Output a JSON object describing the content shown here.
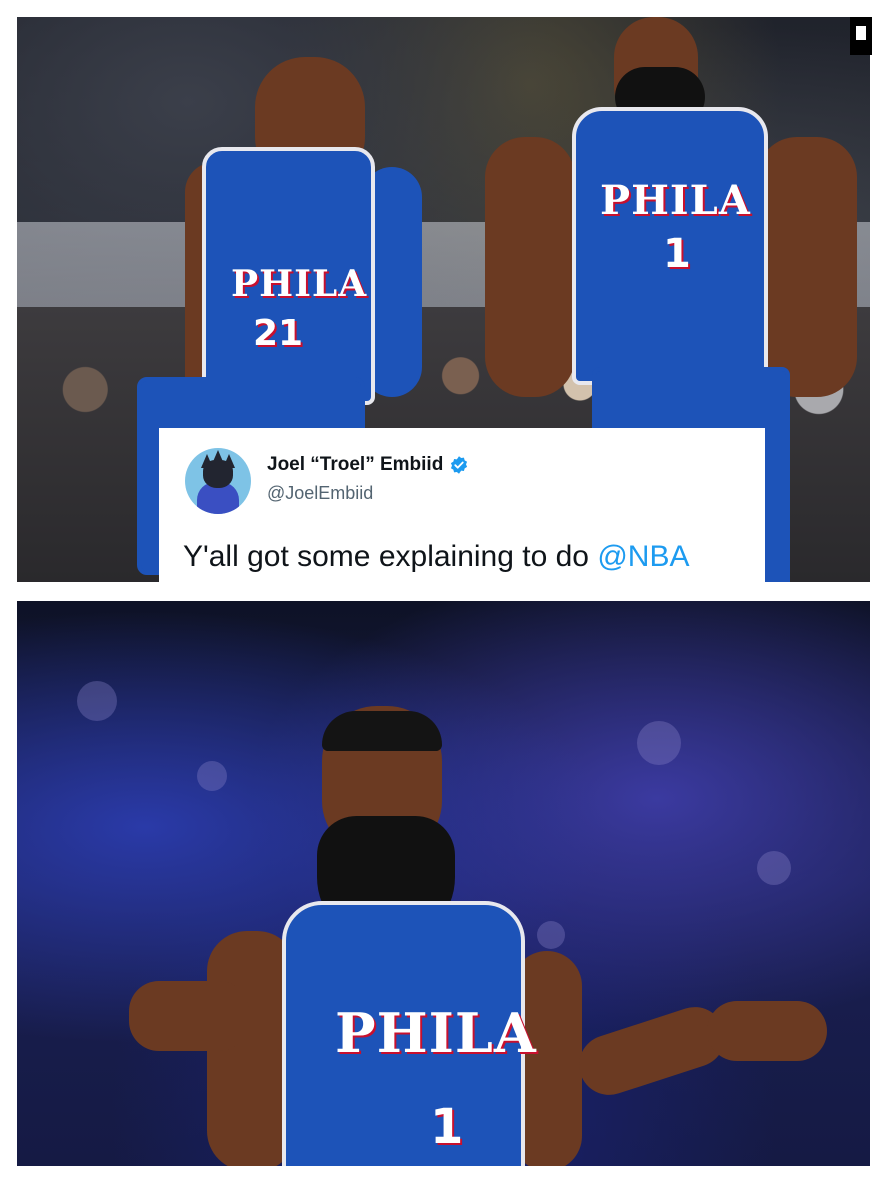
{
  "top_panel": {
    "players": [
      {
        "jersey_word": "PHILA",
        "number": "21"
      },
      {
        "jersey_word": "PHILA",
        "number": "1"
      }
    ],
    "tweet": {
      "display_name": "Joel “Troel” Embiid",
      "handle": "@JoelEmbiid",
      "text": "Y'all got some explaining to do ",
      "mention": "@NBA",
      "verified": true,
      "avatar_icon": "cartoon-avatar-icon"
    }
  },
  "bottom_panel": {
    "player": {
      "jersey_word": "PHILA",
      "number": "1"
    }
  },
  "colors": {
    "jersey_blue": "#1d53b8",
    "jersey_red": "#c8102e",
    "verified_blue": "#1d9bf0",
    "mention_blue": "#1d9bf0"
  }
}
